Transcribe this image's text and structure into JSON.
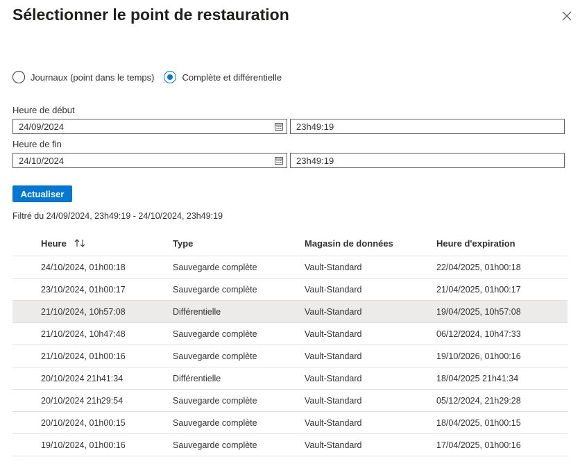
{
  "dialog": {
    "title": "Sélectionner le point de restauration"
  },
  "restore_type": {
    "options": [
      {
        "label": "Journaux (point dans le temps)",
        "checked": false
      },
      {
        "label": "Complète et différentielle",
        "checked": true
      }
    ]
  },
  "start": {
    "label": "Heure de début",
    "date": "24/09/2024",
    "time": "23h49:19"
  },
  "end": {
    "label": "Heure de fin",
    "date": "24/10/2024",
    "time": "23h49:19"
  },
  "refresh_label": "Actualiser",
  "filter_text": "Filtré du 24/09/2024, 23h49:19 - 24/10/2024, 23h49:19",
  "table": {
    "columns": [
      "Heure",
      "Type",
      "Magasin de données",
      "Heure d'expiration"
    ],
    "selected_row": 2,
    "rows": [
      [
        "24/10/2024, 01h00:18",
        "Sauvegarde complète",
        "Vault-Standard",
        "22/04/2025, 01h00:18"
      ],
      [
        "23/10/2024, 01h00:17",
        "Sauvegarde complète",
        "Vault-Standard",
        "21/04/2025, 01h00:17"
      ],
      [
        "21/10/2024, 10h57:08",
        "Différentielle",
        "Vault-Standard",
        "19/04/2025, 10h57:08"
      ],
      [
        "21/10/2024, 10h47:48",
        "Sauvegarde complète",
        "Vault-Standard",
        "06/12/2024, 10h47:33"
      ],
      [
        "21/10/2024, 01h00:16",
        "Sauvegarde complète",
        "Vault-Standard",
        "19/10/2026, 01h00:16"
      ],
      [
        "20/10/2024 21h41:34",
        "Différentielle",
        "Vault-Standard",
        "18/04/2025 21h41:34"
      ],
      [
        "20/10/2024 21h29:54",
        "Sauvegarde complète",
        "Vault-Standard",
        "05/12/2024, 21h29:28"
      ],
      [
        "20/10/2024, 01h00:15",
        "Sauvegarde complète",
        "Vault-Standard",
        "18/04/2025, 01h00:15"
      ],
      [
        "19/10/2024, 01h00:16",
        "Sauvegarde complète",
        "Vault-Standard",
        "17/04/2025, 01h00:16"
      ]
    ]
  },
  "colors": {
    "accent": "#0078d4",
    "selected_row": "#edebe9"
  },
  "icons": {
    "close": "close-icon",
    "calendar": "calendar-icon",
    "sort": "sort-icon"
  }
}
